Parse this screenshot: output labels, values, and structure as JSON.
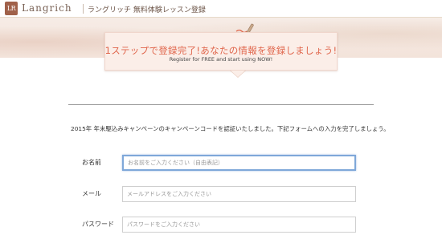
{
  "header": {
    "logo_mark": "LR",
    "logo_text": "Langrich",
    "title": "ラングリッチ 無料体験レッスン登録"
  },
  "banner": {
    "title": "1ステップで登録完了!あなたの情報を登録しましょう!",
    "subtitle": "Register for FREE and start using NOW!"
  },
  "notice": {
    "text": "2015年 年末駆込みキャンペーンのキャンペーンコードを認証いたしました。下記フォームへの入力を完了しましょう。"
  },
  "form": {
    "name": {
      "label": "お名前",
      "placeholder": "お名前をご入力ください（自由表記）"
    },
    "email": {
      "label": "メール",
      "placeholder": "メールアドレスをご入力ください"
    },
    "password": {
      "label": "パスワード",
      "placeholder": "パスワードをご入力ください"
    }
  },
  "colors": {
    "accent": "#e0664c",
    "logo": "#a0614a",
    "focus": "#7fa8d9"
  }
}
